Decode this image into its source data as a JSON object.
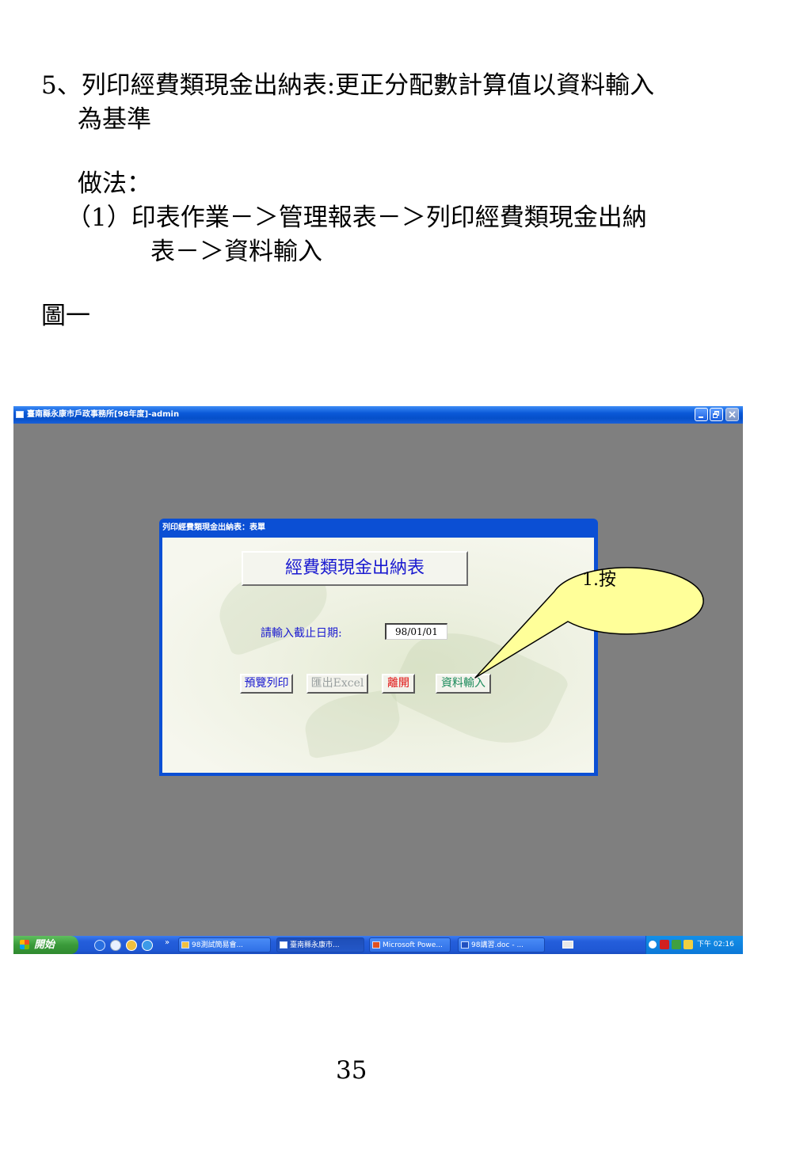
{
  "document": {
    "line1": "5、列印經費類現金出納表:更正分配數計算值以資料輸入",
    "line2": "為基準",
    "method_label": "做法：",
    "step1_line1": "（1）印表作業－＞管理報表－＞列印經費類現金出納",
    "step1_line2": "表－＞資料輸入",
    "figure_label": "圖一",
    "page_number": "35"
  },
  "window": {
    "title": "臺南縣永康市戶政事務所[98年度]-admin"
  },
  "dialog": {
    "title": "列印經費類現金出納表：表單",
    "report_title": "經費類現金出納表",
    "date_label": "請輸入截止日期:",
    "date_value": "98/01/01",
    "buttons": {
      "preview": "預覽列印",
      "excel": "匯出Excel",
      "leave": "離開",
      "data_input": "資料輸入"
    }
  },
  "callout": {
    "text": "1.按"
  },
  "taskbar": {
    "start_label": "開始",
    "overflow": "»",
    "tasks": [
      "98測試簡易會...",
      "臺南縣永康市...",
      "Microsoft Powe...",
      "98講習.doc - ..."
    ],
    "clock": "下午 02:16"
  },
  "colors": {
    "xp_blue": "#0b4fd4",
    "desktop_gray": "#7f7f7f",
    "callout_fill": "#ffff99",
    "accent_blue_text": "#1a1ad0"
  }
}
